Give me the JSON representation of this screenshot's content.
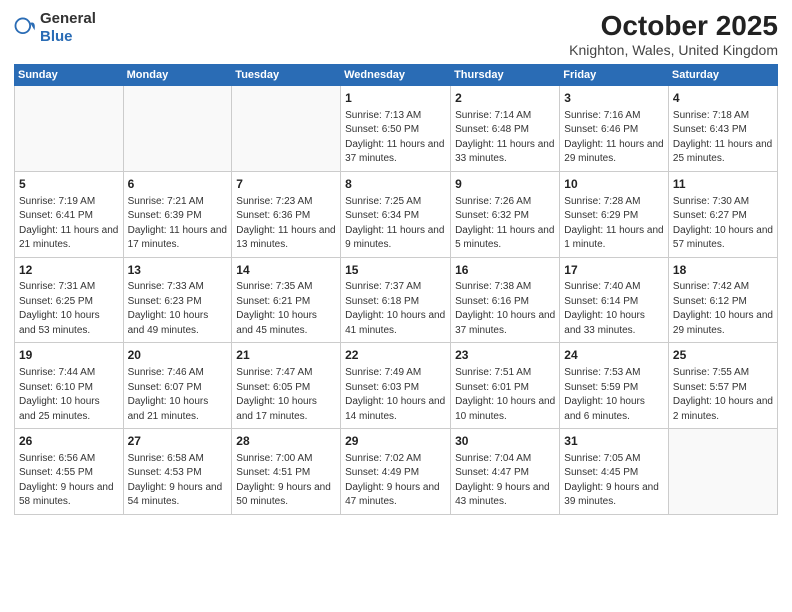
{
  "header": {
    "logo_line1": "General",
    "logo_line2": "Blue",
    "month": "October 2025",
    "location": "Knighton, Wales, United Kingdom"
  },
  "weekdays": [
    "Sunday",
    "Monday",
    "Tuesday",
    "Wednesday",
    "Thursday",
    "Friday",
    "Saturday"
  ],
  "weeks": [
    [
      {
        "day": "",
        "detail": ""
      },
      {
        "day": "",
        "detail": ""
      },
      {
        "day": "",
        "detail": ""
      },
      {
        "day": "1",
        "detail": "Sunrise: 7:13 AM\nSunset: 6:50 PM\nDaylight: 11 hours\nand 37 minutes."
      },
      {
        "day": "2",
        "detail": "Sunrise: 7:14 AM\nSunset: 6:48 PM\nDaylight: 11 hours\nand 33 minutes."
      },
      {
        "day": "3",
        "detail": "Sunrise: 7:16 AM\nSunset: 6:46 PM\nDaylight: 11 hours\nand 29 minutes."
      },
      {
        "day": "4",
        "detail": "Sunrise: 7:18 AM\nSunset: 6:43 PM\nDaylight: 11 hours\nand 25 minutes."
      }
    ],
    [
      {
        "day": "5",
        "detail": "Sunrise: 7:19 AM\nSunset: 6:41 PM\nDaylight: 11 hours\nand 21 minutes."
      },
      {
        "day": "6",
        "detail": "Sunrise: 7:21 AM\nSunset: 6:39 PM\nDaylight: 11 hours\nand 17 minutes."
      },
      {
        "day": "7",
        "detail": "Sunrise: 7:23 AM\nSunset: 6:36 PM\nDaylight: 11 hours\nand 13 minutes."
      },
      {
        "day": "8",
        "detail": "Sunrise: 7:25 AM\nSunset: 6:34 PM\nDaylight: 11 hours\nand 9 minutes."
      },
      {
        "day": "9",
        "detail": "Sunrise: 7:26 AM\nSunset: 6:32 PM\nDaylight: 11 hours\nand 5 minutes."
      },
      {
        "day": "10",
        "detail": "Sunrise: 7:28 AM\nSunset: 6:29 PM\nDaylight: 11 hours\nand 1 minute."
      },
      {
        "day": "11",
        "detail": "Sunrise: 7:30 AM\nSunset: 6:27 PM\nDaylight: 10 hours\nand 57 minutes."
      }
    ],
    [
      {
        "day": "12",
        "detail": "Sunrise: 7:31 AM\nSunset: 6:25 PM\nDaylight: 10 hours\nand 53 minutes."
      },
      {
        "day": "13",
        "detail": "Sunrise: 7:33 AM\nSunset: 6:23 PM\nDaylight: 10 hours\nand 49 minutes."
      },
      {
        "day": "14",
        "detail": "Sunrise: 7:35 AM\nSunset: 6:21 PM\nDaylight: 10 hours\nand 45 minutes."
      },
      {
        "day": "15",
        "detail": "Sunrise: 7:37 AM\nSunset: 6:18 PM\nDaylight: 10 hours\nand 41 minutes."
      },
      {
        "day": "16",
        "detail": "Sunrise: 7:38 AM\nSunset: 6:16 PM\nDaylight: 10 hours\nand 37 minutes."
      },
      {
        "day": "17",
        "detail": "Sunrise: 7:40 AM\nSunset: 6:14 PM\nDaylight: 10 hours\nand 33 minutes."
      },
      {
        "day": "18",
        "detail": "Sunrise: 7:42 AM\nSunset: 6:12 PM\nDaylight: 10 hours\nand 29 minutes."
      }
    ],
    [
      {
        "day": "19",
        "detail": "Sunrise: 7:44 AM\nSunset: 6:10 PM\nDaylight: 10 hours\nand 25 minutes."
      },
      {
        "day": "20",
        "detail": "Sunrise: 7:46 AM\nSunset: 6:07 PM\nDaylight: 10 hours\nand 21 minutes."
      },
      {
        "day": "21",
        "detail": "Sunrise: 7:47 AM\nSunset: 6:05 PM\nDaylight: 10 hours\nand 17 minutes."
      },
      {
        "day": "22",
        "detail": "Sunrise: 7:49 AM\nSunset: 6:03 PM\nDaylight: 10 hours\nand 14 minutes."
      },
      {
        "day": "23",
        "detail": "Sunrise: 7:51 AM\nSunset: 6:01 PM\nDaylight: 10 hours\nand 10 minutes."
      },
      {
        "day": "24",
        "detail": "Sunrise: 7:53 AM\nSunset: 5:59 PM\nDaylight: 10 hours\nand 6 minutes."
      },
      {
        "day": "25",
        "detail": "Sunrise: 7:55 AM\nSunset: 5:57 PM\nDaylight: 10 hours\nand 2 minutes."
      }
    ],
    [
      {
        "day": "26",
        "detail": "Sunrise: 6:56 AM\nSunset: 4:55 PM\nDaylight: 9 hours\nand 58 minutes."
      },
      {
        "day": "27",
        "detail": "Sunrise: 6:58 AM\nSunset: 4:53 PM\nDaylight: 9 hours\nand 54 minutes."
      },
      {
        "day": "28",
        "detail": "Sunrise: 7:00 AM\nSunset: 4:51 PM\nDaylight: 9 hours\nand 50 minutes."
      },
      {
        "day": "29",
        "detail": "Sunrise: 7:02 AM\nSunset: 4:49 PM\nDaylight: 9 hours\nand 47 minutes."
      },
      {
        "day": "30",
        "detail": "Sunrise: 7:04 AM\nSunset: 4:47 PM\nDaylight: 9 hours\nand 43 minutes."
      },
      {
        "day": "31",
        "detail": "Sunrise: 7:05 AM\nSunset: 4:45 PM\nDaylight: 9 hours\nand 39 minutes."
      },
      {
        "day": "",
        "detail": ""
      }
    ]
  ]
}
